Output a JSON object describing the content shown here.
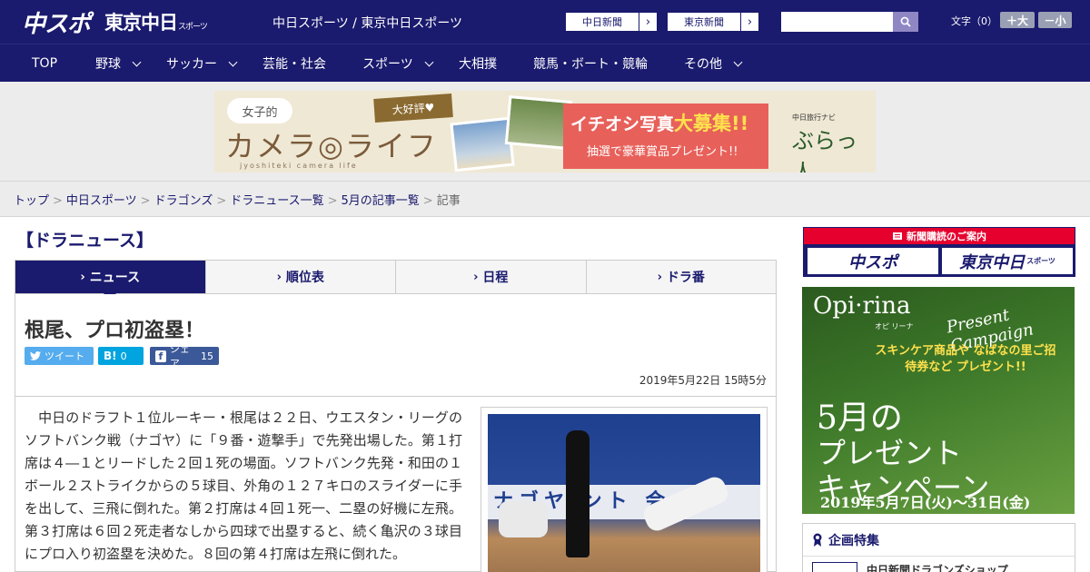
{
  "header": {
    "logo_main": "中スポ",
    "logo_sub": "東京中日",
    "logo_sub_small": "スポーツ",
    "site_links": "中日スポーツ / 東京中日スポーツ",
    "paper_buttons": [
      {
        "label": "中日新聞"
      },
      {
        "label": "東京新聞"
      }
    ],
    "search": {
      "placeholder": ""
    },
    "font_size": {
      "label": "文字（0）",
      "plus": "＋大",
      "minus": "－小"
    }
  },
  "nav": {
    "items": [
      {
        "label": "TOP"
      },
      {
        "label": "野球"
      },
      {
        "label": "サッカー"
      },
      {
        "label": "芸能・社会"
      },
      {
        "label": "スポーツ"
      },
      {
        "label": "大相撲"
      },
      {
        "label": "競馬・ボート・競輪"
      },
      {
        "label": "その他"
      }
    ]
  },
  "banner": {
    "bubble": "女子的",
    "title": "カメラ◎ライフ",
    "roman": "jyoshiteki camera life",
    "badge": "大好評♥",
    "headline_a": "イチオシ写真",
    "headline_b": "大募集!!",
    "subline": "抽選で豪華賞品プレゼント!!",
    "nav_small": "中日旅行ナビ",
    "nav_logo": "ぶらっ人"
  },
  "breadcrumb": {
    "items": [
      {
        "label": "トップ"
      },
      {
        "label": "中日スポーツ"
      },
      {
        "label": "ドラゴンズ"
      },
      {
        "label": "ドラニュース一覧"
      },
      {
        "label": "5月の記事一覧"
      }
    ],
    "separator": ">",
    "current": "記事"
  },
  "section_title": "【ドラニュース】",
  "tabs": [
    {
      "label": "ニュース",
      "active": true
    },
    {
      "label": "順位表",
      "active": false
    },
    {
      "label": "日程",
      "active": false
    },
    {
      "label": "ドラ番",
      "active": false
    }
  ],
  "article": {
    "title": "根尾、プロ初盗塁！",
    "share": {
      "tweet": "ツイート",
      "hatena_icon": "B!",
      "hatena_count": "0",
      "facebook_icon": "f",
      "facebook_label": "シェア",
      "facebook_count": "15"
    },
    "date": "2019年5月22日 15時5分",
    "body": "　中日のドラフト１位ルーキー・根尾は２２日、ウエスタン・リーグのソフトバンク戦（ナゴヤ）に「９番・遊撃手」で先発出場した。第１打席は４―１とリードした２回１死の場面。ソフトバンク先発・和田の１ボール２ストライクからの５球目、外角の１２７キロのスライダーに手を出して、三飛に倒れた。第２打席は４回１死一、二塁の好機に左飛。第３打席は６回２死走者なしから四球で出塁すると、続く亀沢の３球目にプロ入り初盗塁を決めた。８回の第４打席は左飛に倒れた。",
    "photo_sign": "ナゴヤ ント 会"
  },
  "sidebar": {
    "subscribe_head": "新聞購読のご案内",
    "subscribe_a": "中スポ",
    "subscribe_b": "東京中日",
    "subscribe_b_small": "スポーツ",
    "ad": {
      "brand": "Opi·rina",
      "brand_small": "オピ リーナ",
      "script": "Present Campaign",
      "yellow": "スキンケア商品や なばなの里ご招待券など プレゼント!!",
      "big_a": "5月の",
      "big_b": "プレゼント",
      "big_c": "キャンペーン",
      "date": "2019年5月7日(火)〜31日(金)"
    },
    "feature_head": "企画特集",
    "feature_item": "中日新聞ドラゴンズショップ"
  }
}
